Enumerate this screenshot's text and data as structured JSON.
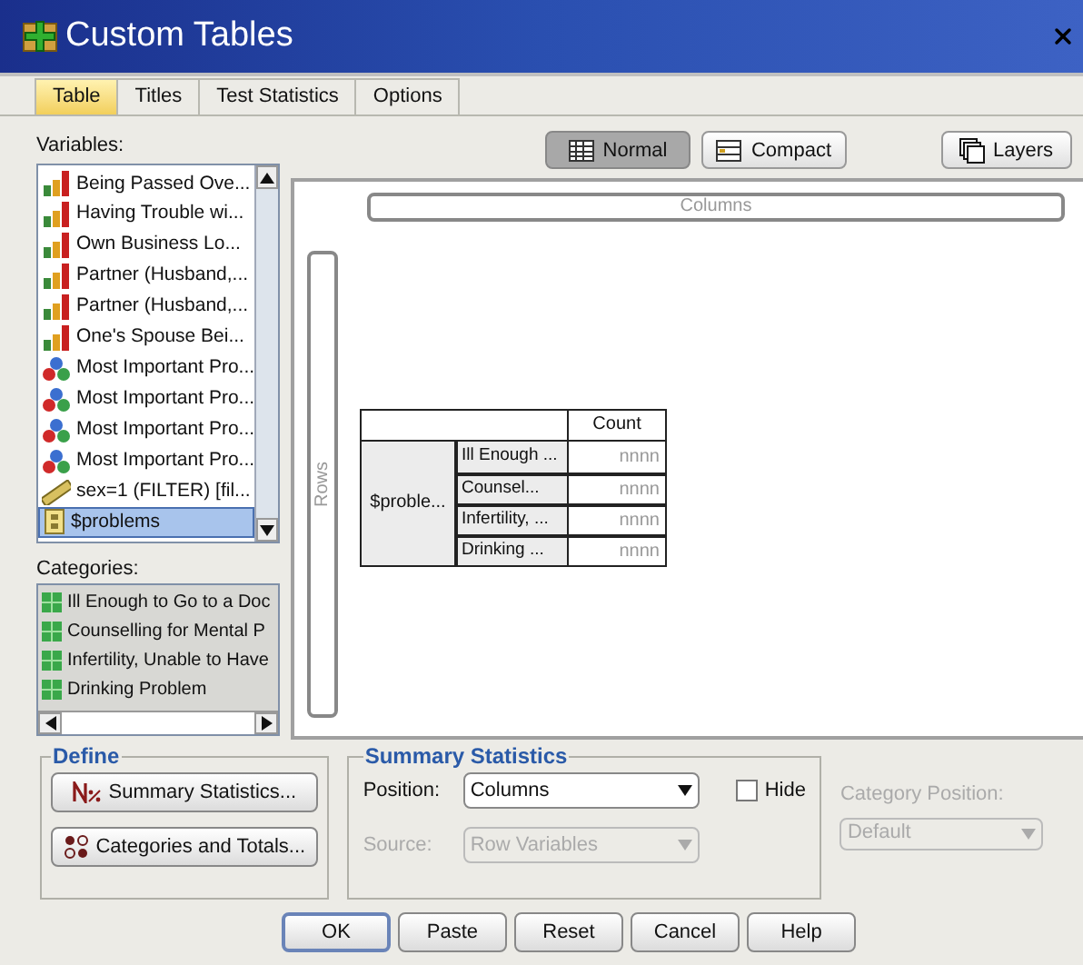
{
  "window": {
    "title": "Custom Tables"
  },
  "tabs": [
    {
      "label": "Table",
      "selected": true
    },
    {
      "label": "Titles",
      "selected": false
    },
    {
      "label": "Test Statistics",
      "selected": false
    },
    {
      "label": "Options",
      "selected": false
    }
  ],
  "variables_label": "Variables:",
  "variables": [
    {
      "label": "Being Passed Ove...",
      "kind": "ordinal",
      "selected": false
    },
    {
      "label": "Having Trouble wi...",
      "kind": "ordinal",
      "selected": false
    },
    {
      "label": "Own Business Lo...",
      "kind": "ordinal",
      "selected": false
    },
    {
      "label": "Partner (Husband,...",
      "kind": "ordinal",
      "selected": false
    },
    {
      "label": "Partner (Husband,...",
      "kind": "ordinal",
      "selected": false
    },
    {
      "label": "One's Spouse Bei...",
      "kind": "ordinal",
      "selected": false
    },
    {
      "label": "Most Important Pro...",
      "kind": "nominal",
      "selected": false
    },
    {
      "label": "Most Important Pro...",
      "kind": "nominal",
      "selected": false
    },
    {
      "label": "Most Important Pro...",
      "kind": "nominal",
      "selected": false
    },
    {
      "label": "Most Important Pro...",
      "kind": "nominal",
      "selected": false
    },
    {
      "label": "sex=1 (FILTER) [fil...",
      "kind": "scale",
      "selected": false
    },
    {
      "label": "$problems",
      "kind": "set",
      "selected": true
    }
  ],
  "categories_label": "Categories:",
  "categories": [
    "Ill Enough to Go to a Doc",
    "Counselling for Mental P",
    "Infertility, Unable to Have",
    "Drinking Problem"
  ],
  "view_buttons": [
    {
      "label": "Normal",
      "kind": "normal",
      "selected": true
    },
    {
      "label": "Compact",
      "kind": "compact",
      "selected": false
    }
  ],
  "layers_button": "Layers",
  "columns_label": "Columns",
  "rows_label": "Rows",
  "table": {
    "header": "Count",
    "row_variable": "$proble...",
    "rows": [
      {
        "label": "Ill Enough ...",
        "value": "nnnn"
      },
      {
        "label": "Counsel...",
        "value": "nnnn"
      },
      {
        "label": "Infertility, ...",
        "value": "nnnn"
      },
      {
        "label": "Drinking ...",
        "value": "nnnn"
      }
    ]
  },
  "define": {
    "title": "Define",
    "buttons": [
      {
        "label": "Summary Statistics...",
        "kind": "stats"
      },
      {
        "label": "Categories and Totals...",
        "kind": "categories"
      }
    ]
  },
  "summary": {
    "title": "Summary Statistics",
    "position_label": "Position:",
    "position_value": "Columns",
    "hide_label": "Hide",
    "hide_checked": false,
    "source_label": "Source:",
    "source_value": "Row Variables",
    "source_disabled": true
  },
  "category_position": {
    "label": "Category Position:",
    "value": "Default",
    "disabled": true
  },
  "buttons": [
    {
      "label": "OK",
      "default": true
    },
    {
      "label": "Paste",
      "default": false
    },
    {
      "label": "Reset",
      "default": false
    },
    {
      "label": "Cancel",
      "default": false
    },
    {
      "label": "Help",
      "default": false
    }
  ]
}
